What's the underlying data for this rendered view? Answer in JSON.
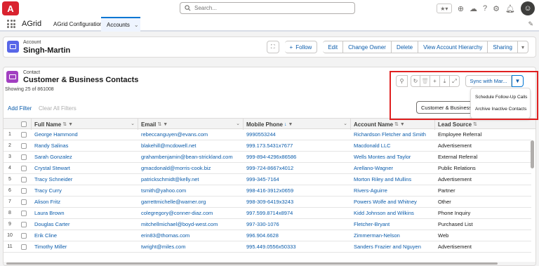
{
  "header": {
    "logo": "A",
    "search_placeholder": "Search..."
  },
  "nav": {
    "app_name": "AGrid",
    "tabs": [
      {
        "label": "AGrid Configuration"
      },
      {
        "label": "Accounts"
      }
    ]
  },
  "record": {
    "type": "Account",
    "name": "Singh-Martin",
    "actions": {
      "follow": "Follow",
      "edit": "Edit",
      "change_owner": "Change Owner",
      "delete": "Delete",
      "view_hierarchy": "View Account Hierarchy",
      "sharing": "Sharing"
    }
  },
  "list": {
    "type": "Contact",
    "title": "Customer & Business Contacts",
    "count_text": "Showing 25 of 861008",
    "add_filter": "Add Filter",
    "clear_filters": "Clear All Filters",
    "sync_button": "Sync with Mar...",
    "segment_button": "Customer & Business C",
    "menu_items": [
      "Schedule Follow-Up Calls",
      "Archive Inactive Contacts"
    ]
  },
  "table": {
    "columns": [
      "Full Name",
      "Email",
      "Mobile Phone",
      "Account Name",
      "Lead Source"
    ],
    "rows": [
      {
        "n": "1",
        "name": "George Hammond",
        "email": "rebeccanguyen@evans.com",
        "phone": "9990553244",
        "account": "Richardson Fletcher and Smith",
        "source": "Employee Referral"
      },
      {
        "n": "2",
        "name": "Randy Salinas",
        "email": "blakehill@mcdowell.net",
        "phone": "999.173.5431x7677",
        "account": "Macdonald LLC",
        "source": "Advertisement"
      },
      {
        "n": "3",
        "name": "Sarah Gonzalez",
        "email": "grahambenjamin@bean-strickland.com",
        "phone": "999-894-4296x86586",
        "account": "Wells Montes and Taylor",
        "source": "External Referral"
      },
      {
        "n": "4",
        "name": "Crystal Stewart",
        "email": "gmacdonald@morris-cook.biz",
        "phone": "999-724-8667x4012",
        "account": "Arellano-Wagner",
        "source": "Public Relations"
      },
      {
        "n": "5",
        "name": "Tracy Schneider",
        "email": "patrickschmidt@kelly.net",
        "phone": "999-345-7164",
        "account": "Morton Riley and Mullins",
        "source": "Advertisement"
      },
      {
        "n": "6",
        "name": "Tracy Curry",
        "email": "tsmith@yahoo.com",
        "phone": "998-416-3912x0659",
        "account": "Rivers-Aguirre",
        "source": "Partner"
      },
      {
        "n": "7",
        "name": "Alison Fritz",
        "email": "garrettmichelle@warner.org",
        "phone": "998-309-6419x3243",
        "account": "Powers Wolfe and Whitney",
        "source": "Other"
      },
      {
        "n": "8",
        "name": "Laura Brown",
        "email": "colegregory@conner-diaz.com",
        "phone": "997.599.8714x8974",
        "account": "Kidd Johnson and Wilkins",
        "source": "Phone Inquiry"
      },
      {
        "n": "9",
        "name": "Douglas Carter",
        "email": "mitchellmichael@boyd-west.com",
        "phone": "997-330-1076",
        "account": "Fletcher-Bryant",
        "source": "Purchased List"
      },
      {
        "n": "10",
        "name": "Erik Cline",
        "email": "erin83@thomas.com",
        "phone": "996.904.6628",
        "account": "Zimmerman-Nelson",
        "source": "Web"
      },
      {
        "n": "11",
        "name": "Timothy Miller",
        "email": "twright@miles.com",
        "phone": "995.449.0556x50333",
        "account": "Sanders Frazier and Nguyen",
        "source": "Advertisement"
      }
    ]
  },
  "colors": {
    "brand_red": "#d9232f",
    "link_blue": "#0b5cab",
    "highlight_red": "#e02020",
    "record_icon": "#5867e8",
    "list_icon": "#a23fc1"
  }
}
